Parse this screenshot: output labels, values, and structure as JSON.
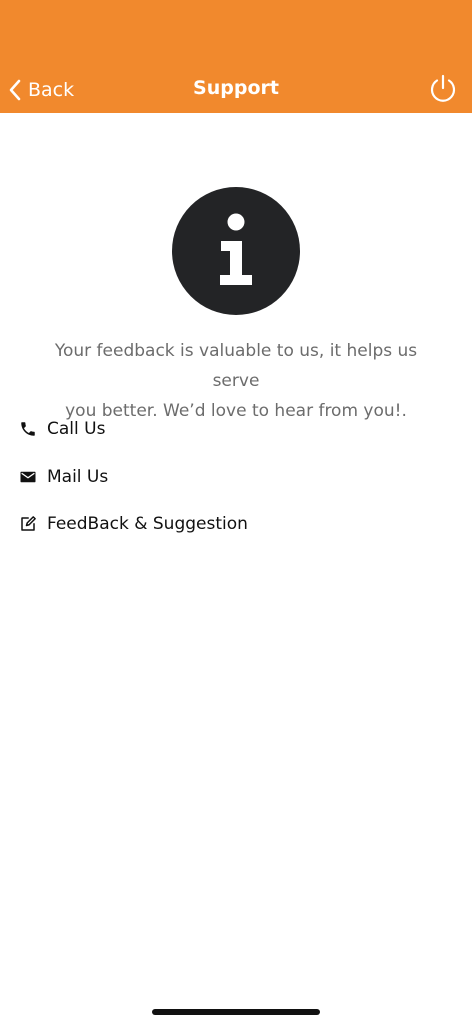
{
  "header": {
    "back_label": "Back",
    "title": "Support",
    "background_color": "#F1892D"
  },
  "icons": {
    "back": "chevron-left-icon",
    "power": "power-icon",
    "info": "info-icon"
  },
  "main": {
    "feedback_line1": "Your feedback is valuable to us, it helps us serve",
    "feedback_line2": "you better. We’d love to hear from you!."
  },
  "menu": {
    "items": [
      {
        "label": "Call Us",
        "icon": "phone-icon"
      },
      {
        "label": "Mail Us",
        "icon": "mail-icon"
      },
      {
        "label": "FeedBack & Suggestion",
        "icon": "edit-icon"
      }
    ]
  }
}
